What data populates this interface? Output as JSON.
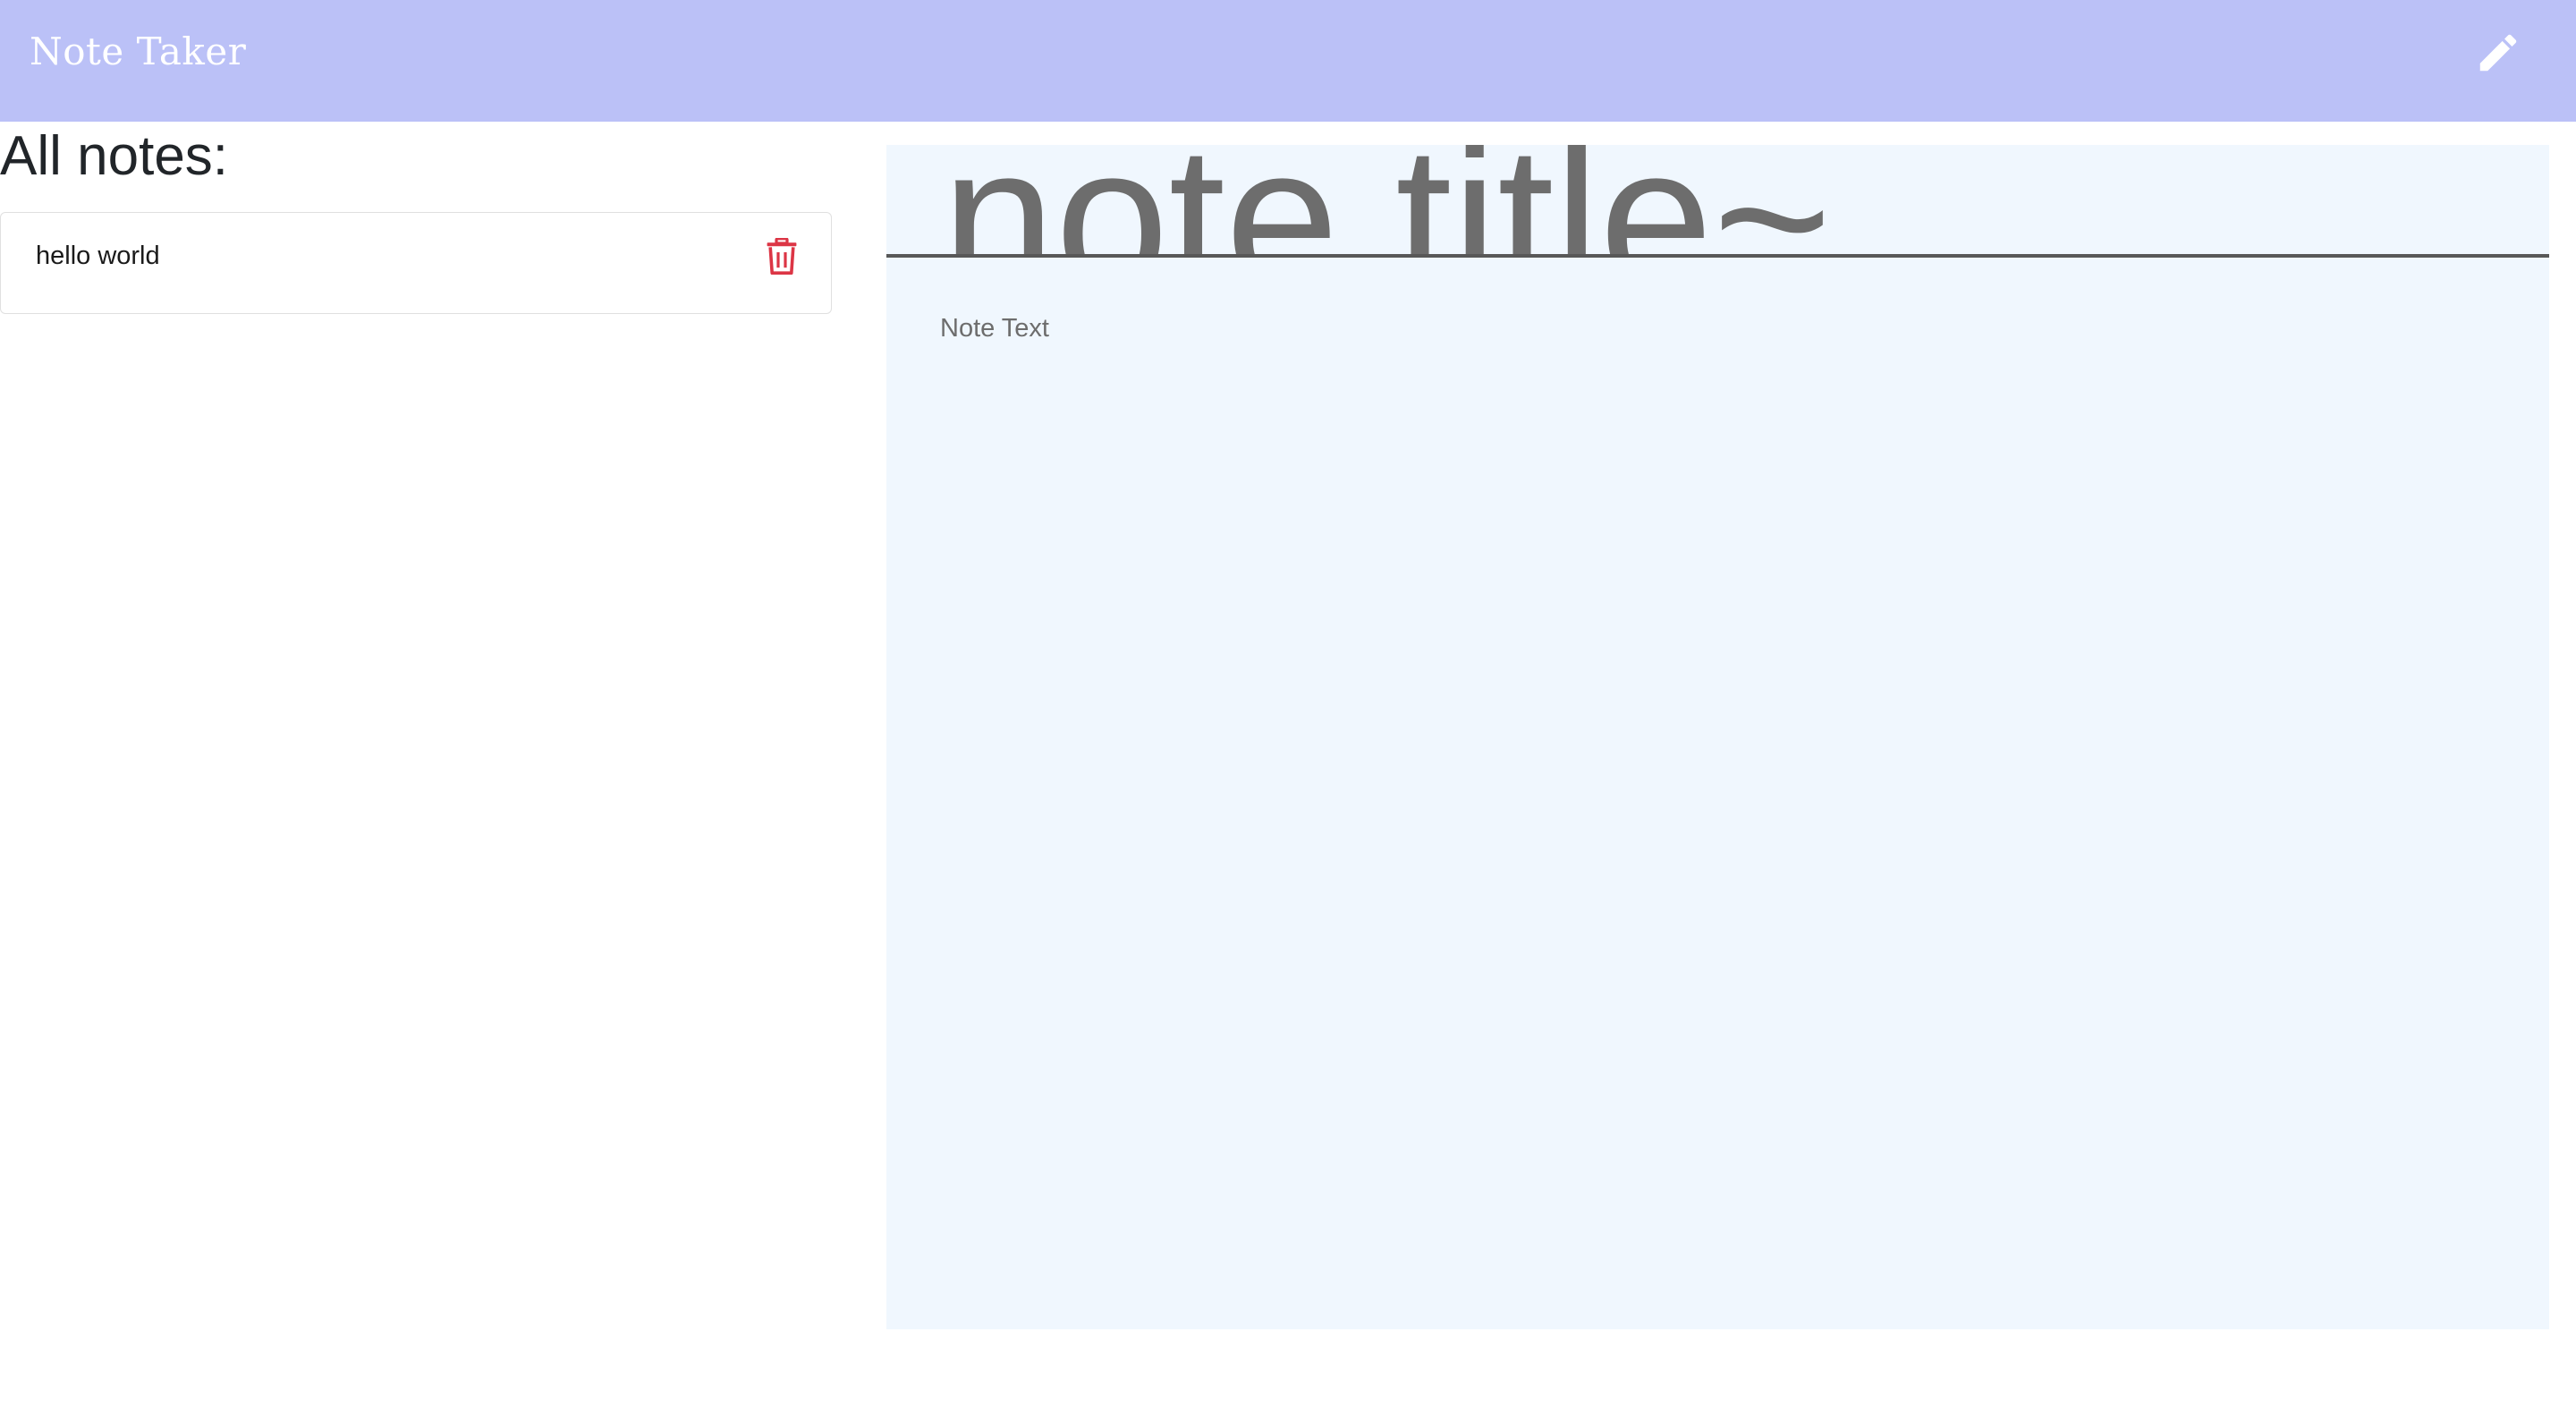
{
  "navbar": {
    "brand": "Note Taker",
    "new_note_icon": "pencil-icon"
  },
  "notes_list": {
    "heading": "All notes:",
    "items": [
      {
        "title": "hello world",
        "delete_icon": "trash-icon",
        "delete_color": "#dc3545"
      }
    ]
  },
  "editor": {
    "title_placeholder": "note title~",
    "text_placeholder": "Note Text"
  },
  "colors": {
    "navbar_bg": "#bbc1f7",
    "editor_bg": "#f0f7fe",
    "placeholder": "#6d6d6d"
  }
}
